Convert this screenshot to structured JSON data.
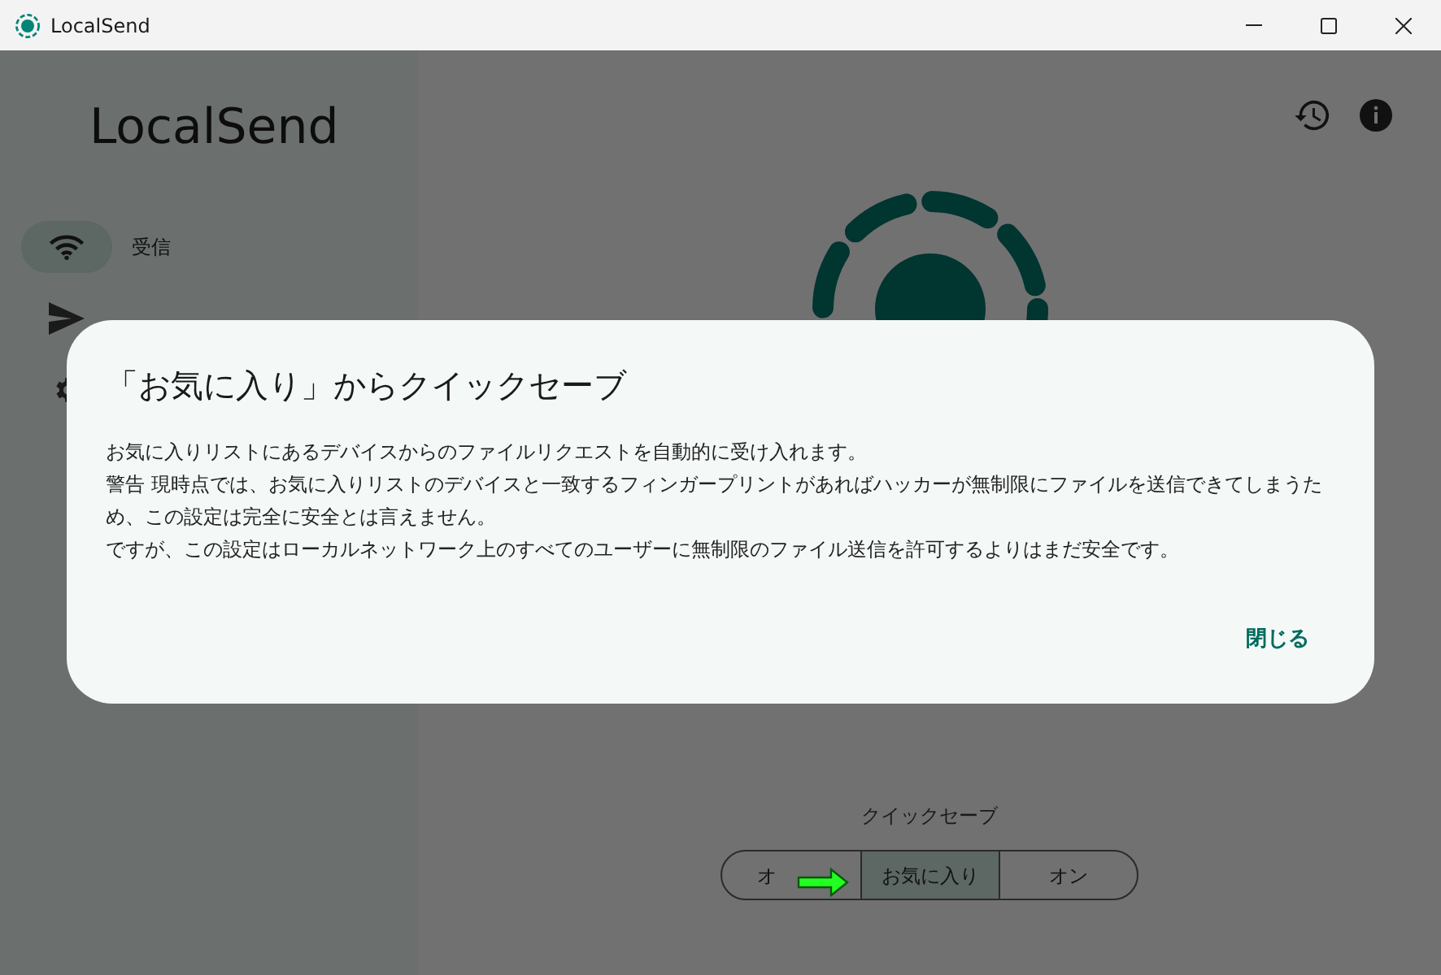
{
  "window": {
    "title": "LocalSend"
  },
  "sidebar": {
    "app_name": "LocalSend",
    "items": [
      {
        "kind": "receive",
        "label": "受信",
        "selected": true
      },
      {
        "kind": "send",
        "selected": false
      },
      {
        "kind": "settings",
        "selected": false
      }
    ]
  },
  "quick_save": {
    "label": "クイックセーブ",
    "options": [
      {
        "label": "オ",
        "selected": false
      },
      {
        "label": "お気に入り",
        "selected": true
      },
      {
        "label": "オン",
        "selected": false
      }
    ]
  },
  "dialog": {
    "title": "「お気に入り」からクイックセーブ",
    "paragraphs": [
      "お気に入りリストにあるデバイスからのファイルリクエストを自動的に受け入れます。",
      "警告 現時点では、お気に入りリストのデバイスと一致するフィンガープリントがあればハッカーが無制限にファイルを送信できてしまうため、この設定は完全に安全とは言えません。",
      "ですが、この設定はローカルネットワーク上のすべてのユーザーに無制限のファイル送信を許可するよりはまだ安全です。"
    ],
    "close": "閉じる"
  }
}
